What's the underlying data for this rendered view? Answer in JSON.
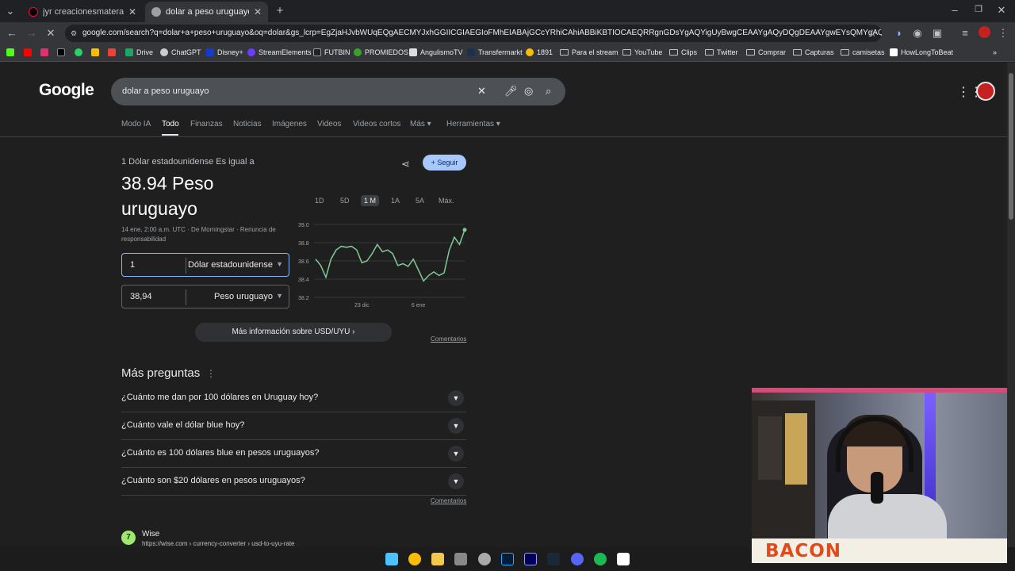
{
  "browser": {
    "tabs": [
      {
        "title": "jyr creacionesmateras (@jyrcrea",
        "active": false
      },
      {
        "title": "dolar a peso uruguayo - Buscar",
        "active": true
      }
    ],
    "url": "google.com/search?q=dolar+a+peso+uruguayo&oq=dolar&gs_lcrp=EgZjaHJvbWUqEQgAECMYJxhGGIICGIAEGIoFMhEIABAjGCcYRhiCAhiABBiKBTIOCAEQRRgnGDsYgAQYigUyBwgCEAAYgAQyDQgDEAAYgwEYsQMYgAQyDQgEEAAYgwEYs",
    "bookmarks": [
      "Drive",
      "ChatGPT",
      "Disney+",
      "StreamElements",
      "FUTBIN",
      "PROMIEDOS",
      "AngulismoTV",
      "Transfermarkt",
      "1891",
      "Para el stream",
      "YouTube",
      "Clips",
      "Twitter",
      "Comprar",
      "Capturas",
      "camisetas",
      "HowLongToBeat"
    ]
  },
  "search": {
    "logo": "Google",
    "query": "dolar a peso uruguayo",
    "tabs": [
      "Modo IA",
      "Todo",
      "Finanzas",
      "Noticias",
      "Imágenes",
      "Videos",
      "Videos cortos",
      "Más",
      "Herramientas"
    ],
    "active_tab": "Todo"
  },
  "converter": {
    "equals_label": "1 Dólar estadounidense Es igual a",
    "value_line1": "38.94 Peso",
    "value_line2": "uruguayo",
    "meta": "14 ene, 2:00 a.m. UTC · De Morningstar · Renuncia de responsabilidad",
    "from_amount": "1",
    "from_currency": "Dólar estadounidense",
    "to_amount": "38,94",
    "to_currency": "Peso uruguayo",
    "follow_label": "Seguir",
    "ranges": [
      "1D",
      "5D",
      "1 M",
      "1A",
      "5A",
      "Máx."
    ],
    "active_range": "1 M",
    "more_info": "Más información sobre USD/UYU",
    "feedback": "Comentarios"
  },
  "chart_data": {
    "type": "line",
    "x_tick_labels": [
      "23 dic",
      "6 ene"
    ],
    "y_ticks": [
      "39.0",
      "38.8",
      "38.6",
      "38.4",
      "38.2"
    ],
    "ylim": [
      38.2,
      39.0
    ],
    "values": [
      38.62,
      38.55,
      38.42,
      38.62,
      38.72,
      38.76,
      38.75,
      38.76,
      38.72,
      38.58,
      38.6,
      38.68,
      38.78,
      38.7,
      38.72,
      38.68,
      38.55,
      38.57,
      38.54,
      38.62,
      38.5,
      38.38,
      38.44,
      38.48,
      38.44,
      38.47,
      38.72,
      38.86,
      38.78,
      38.94
    ],
    "color": "#81c995"
  },
  "faq": {
    "title": "Más preguntas",
    "questions": [
      "¿Cuánto me dan por 100 dólares en Uruguay hoy?",
      "¿Cuánto vale el dólar blue hoy?",
      "¿Cuánto es 100 dólares blue en pesos uruguayos?",
      "¿Cuánto son $20 dólares en pesos uruguayos?"
    ],
    "feedback": "Comentarios"
  },
  "result": {
    "site": "Wise",
    "url": "https://wise.com › currency-converter › usd-to-uyu-rate"
  },
  "overlay": {
    "brand": "BACON"
  }
}
